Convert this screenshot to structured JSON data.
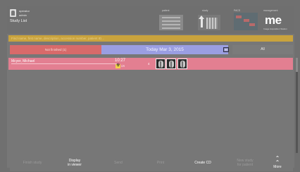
{
  "header": {
    "user_name": "operator",
    "user_role": "admin",
    "app_title": "Study List",
    "tiles": {
      "patient": "patient",
      "study": "study",
      "pacs": "PACS",
      "management": "management",
      "logo_text": "me",
      "logo_sub": "Image Acquisition Station"
    }
  },
  "search": {
    "placeholder": "Find name, first name, description, accession number, patient ID...",
    "value": ""
  },
  "filters": {
    "not_finished": "Not finished (1)",
    "date": "Today Mar 3, 2015",
    "all": "All"
  },
  "studies": [
    {
      "name": "Mcyer, Michael",
      "time": "10:27",
      "modality": "CR",
      "image_count": "4",
      "thumbnails": [
        "chest-xray-1",
        "chest-xray-2",
        "chest-xray-3"
      ]
    }
  ],
  "toolbar": {
    "finish_study": "Finish study",
    "display_line1": "Display",
    "display_line2": "in viewer",
    "send": "Send",
    "print": "Print",
    "create_cd": "Create CD",
    "new_study_line1": "New study",
    "new_study_line2": "for patient",
    "more": "More",
    "more_icon": "double-chevron-up"
  },
  "colors": {
    "search_bar": "#c9a33d",
    "not_finished": "#d86a6a",
    "date_bar": "#9a9ee2",
    "study_row": "#e37f91"
  }
}
